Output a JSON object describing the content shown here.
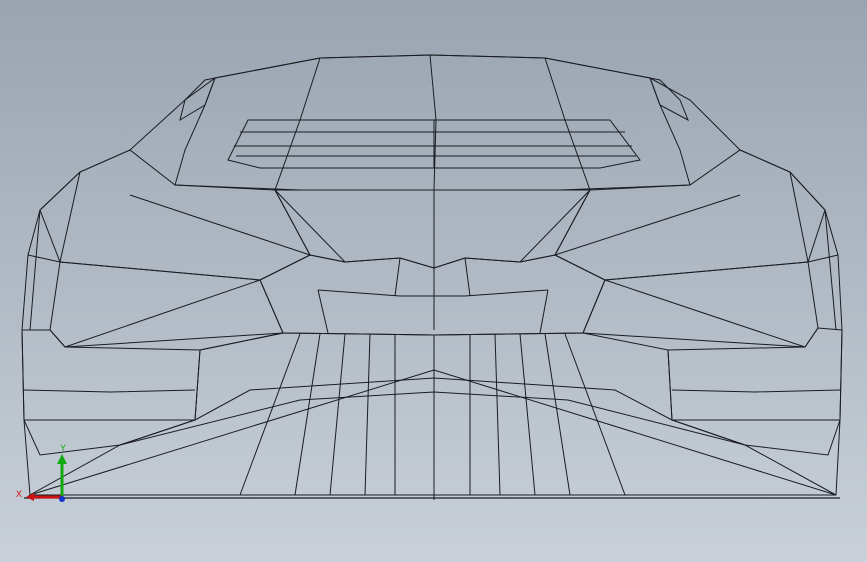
{
  "viewport": {
    "background_top": "#9aa4b0",
    "background_bottom": "#c9d0d8"
  },
  "model": {
    "body_color": "#8e95ab",
    "body_light": "#a6adc1",
    "body_dark": "#6e748a",
    "highlight_color": "#d8d820",
    "edge_color": "#1a1c22"
  },
  "triad": {
    "x_label": "X",
    "y_label": "Y",
    "x_color": "#cc1111",
    "y_color": "#11aa11",
    "z_color": "#1133cc"
  }
}
